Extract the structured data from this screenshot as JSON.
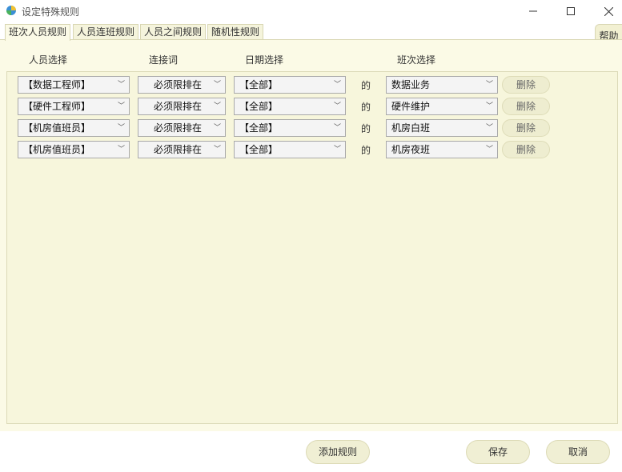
{
  "window": {
    "title": "设定特殊规则",
    "minimize_glyph": "—",
    "maximize_glyph": "☐",
    "close_glyph": "✕"
  },
  "tabs": [
    {
      "label": "班次人员规则",
      "active": true
    },
    {
      "label": "人员连班规则",
      "active": false
    },
    {
      "label": "人员之间规则",
      "active": false
    },
    {
      "label": "随机性规则",
      "active": false
    }
  ],
  "help_label": "帮助",
  "columns": {
    "person": "人员选择",
    "connector": "连接词",
    "date": "日期选择",
    "shift": "班次选择"
  },
  "rules": [
    {
      "person": "【数据工程师】",
      "connector": "必须限排在",
      "date": "【全部】",
      "de": "的",
      "shift": "数据业务",
      "delete": "删除"
    },
    {
      "person": "【硬件工程师】",
      "connector": "必须限排在",
      "date": "【全部】",
      "de": "的",
      "shift": "硬件维护",
      "delete": "删除"
    },
    {
      "person": "【机房值班员】",
      "connector": "必须限排在",
      "date": "【全部】",
      "de": "的",
      "shift": "机房白班",
      "delete": "删除"
    },
    {
      "person": "【机房值班员】",
      "connector": "必须限排在",
      "date": "【全部】",
      "de": "的",
      "shift": "机房夜班",
      "delete": "删除"
    }
  ],
  "buttons": {
    "add": "添加规则",
    "save": "保存",
    "cancel": "取消"
  },
  "icons": {
    "dropdown": "chevron-down-icon",
    "app": "app-logo-icon"
  },
  "colors": {
    "panel_bg": "#fbfae6",
    "rules_bg": "#f7f6dc",
    "button_bg": "#f0efd4"
  }
}
